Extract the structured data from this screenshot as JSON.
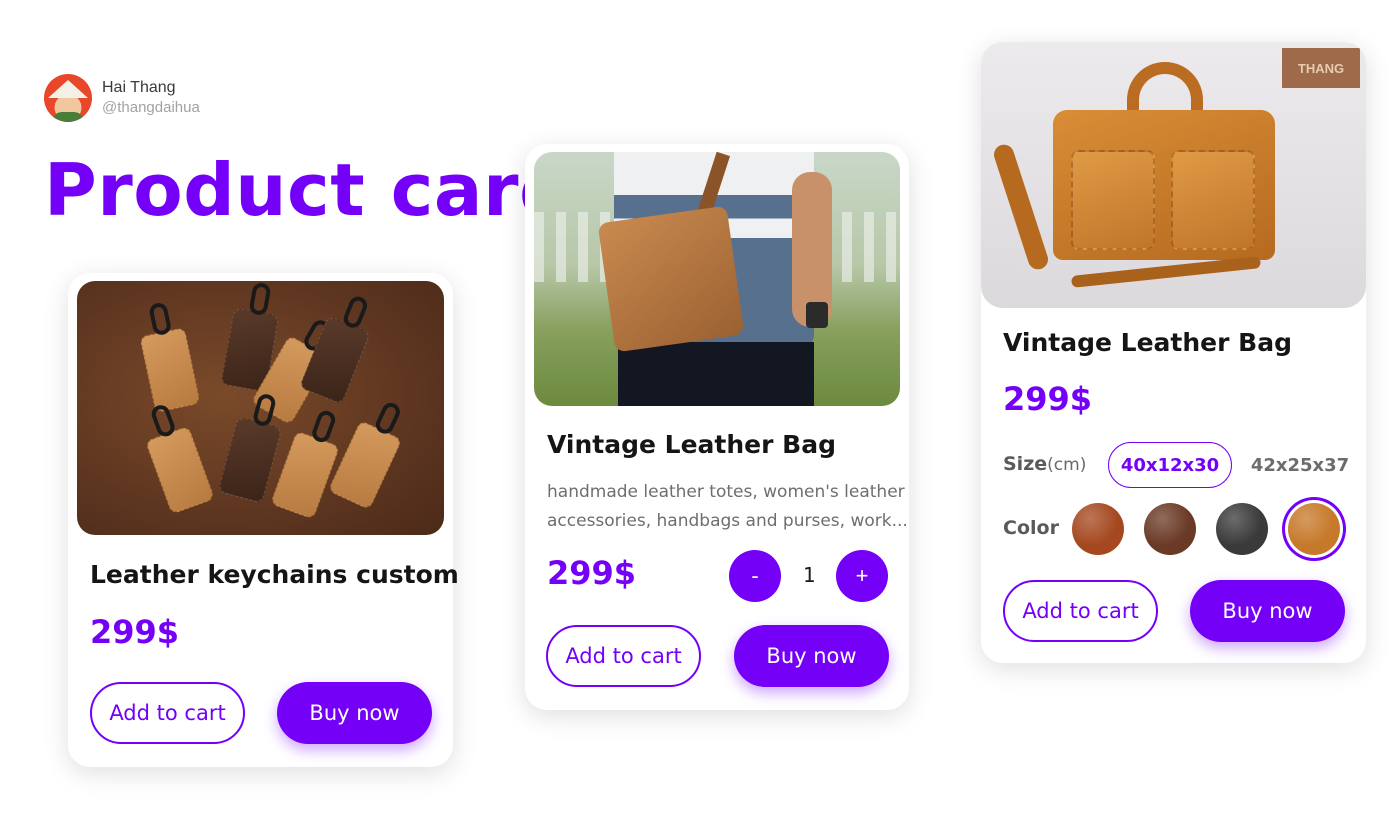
{
  "author": {
    "name": "Hai Thang",
    "handle": "@thangdaihua"
  },
  "page_title": "Product card",
  "cards": [
    {
      "name": "Leather keychains custom",
      "price": "299$",
      "add_to_cart": "Add to cart",
      "buy_now": "Buy now"
    },
    {
      "name": "Vintage Leather Bag",
      "description_line1": "handmade leather totes, women's leather",
      "description_line2": "accessories, handbags and purses, work...",
      "price": "299$",
      "qty_minus": "-",
      "qty_value": "1",
      "qty_plus": "+",
      "add_to_cart": "Add to cart",
      "buy_now": "Buy now"
    },
    {
      "name": "Vintage Leather Bag",
      "price": "299$",
      "logo_text": "THANG",
      "size_label": "Size",
      "size_unit": "(cm)",
      "sizes": [
        "40x12x30",
        "42x25x37"
      ],
      "selected_size": "40x12x30",
      "color_label": "Color",
      "colors": [
        "#a5481f",
        "#6b3a26",
        "#3a3a3a",
        "#c7792a"
      ],
      "selected_color_index": 3,
      "add_to_cart": "Add to cart",
      "buy_now": "Buy now"
    }
  ],
  "accent_color": "#7400f7"
}
